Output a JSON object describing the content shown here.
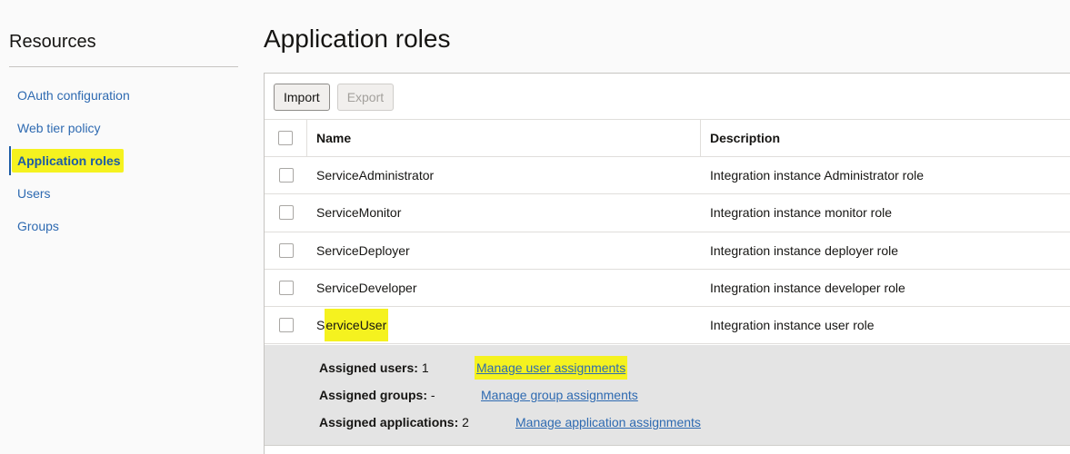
{
  "sidebar": {
    "title": "Resources",
    "items": [
      {
        "label": "OAuth configuration"
      },
      {
        "label": "Web tier policy"
      },
      {
        "label": "Application roles"
      },
      {
        "label": "Users"
      },
      {
        "label": "Groups"
      }
    ]
  },
  "page": {
    "title": "Application roles"
  },
  "toolbar": {
    "import_label": "Import",
    "export_label": "Export"
  },
  "table": {
    "columns": [
      "Name",
      "Description"
    ],
    "rows": [
      {
        "name": "ServiceAdministrator",
        "description": "Integration instance Administrator role"
      },
      {
        "name": "ServiceMonitor",
        "description": "Integration instance monitor role"
      },
      {
        "name": "ServiceDeployer",
        "description": "Integration instance deployer role"
      },
      {
        "name": "ServiceDeveloper",
        "description": "Integration instance developer role"
      },
      {
        "name_prefix": "S",
        "name_rest": "erviceUser",
        "description": "Integration instance user role"
      }
    ]
  },
  "detail": {
    "users_label": "Assigned users:",
    "users_value": "1",
    "users_link": "Manage user assignments",
    "groups_label": "Assigned groups:",
    "groups_value": "-",
    "groups_link": "Manage group assignments",
    "apps_label": "Assigned applications:",
    "apps_value": "2",
    "apps_link": "Manage application assignments"
  },
  "colors": {
    "link": "#2e6ab1",
    "highlight": "#f5f21f",
    "detail_bg": "#e4e4e4"
  }
}
